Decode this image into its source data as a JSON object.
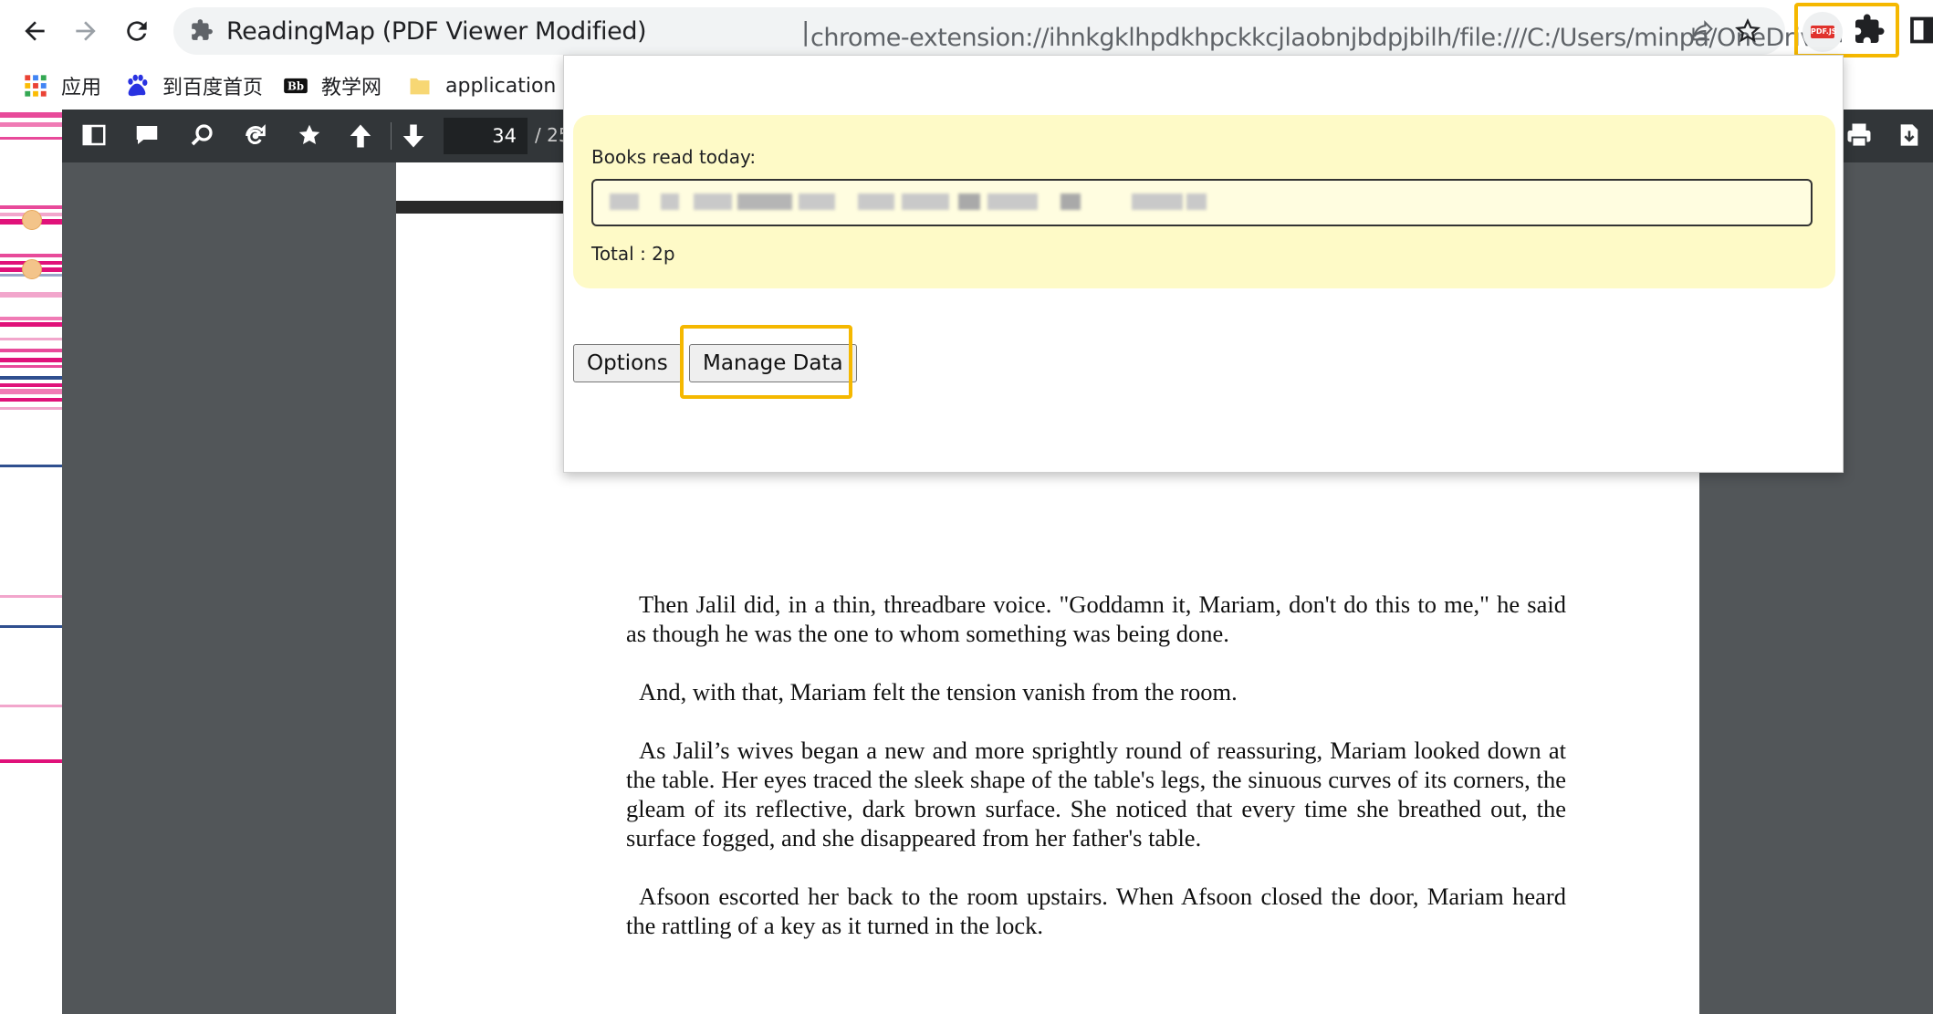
{
  "browser": {
    "tab_extension_name": "ReadingMap (PDF Viewer Modified)",
    "separator": "|",
    "url": "chrome-extension://ihnkgklhpdkhpckkcjlaobnjbdpjbilh/file:///C:/Users/minpa/OneDrive/电子书...",
    "icons": {
      "back": "back-arrow-icon",
      "forward": "forward-arrow-icon",
      "reload": "reload-icon",
      "share": "share-icon",
      "bookmark": "star-icon",
      "pdf_extension": "pdf-extension-icon",
      "extensions": "puzzle-icon",
      "side_panel": "side-panel-icon"
    },
    "pdf_badge": "PDF.JS"
  },
  "bookmarks": [
    {
      "label": "应用",
      "icon": "apps-grid-icon"
    },
    {
      "label": "到百度首页",
      "icon": "baidu-paw-icon"
    },
    {
      "label": "教学网",
      "icon": "blackboard-icon"
    },
    {
      "label": "application",
      "icon": "folder-icon"
    }
  ],
  "pdf_viewer": {
    "current_page": "34",
    "total_pages": "/ 25",
    "toolbar_icons": [
      "sidebar-toggle-icon",
      "comment-icon",
      "search-icon",
      "rotate-icon",
      "star-icon",
      "previous-page-icon",
      "next-page-icon",
      "print-icon",
      "download-icon"
    ],
    "paragraphs": [
      "Then Jalil did, in a thin, threadbare voice. \"Goddamn it, Mariam, don't do this to me,\" he said as though he was the one to whom something was being done.",
      "And, with that, Mariam felt the tension vanish from the room.",
      "As Jalil’s wives began a new and more sprightly round of reassuring, Mariam looked down at the table. Her eyes traced the sleek shape of the table's legs, the sinuous curves of its corners, the gleam of its reflective, dark brown surface. She noticed that every time she breathed out, the surface fogged, and she disappeared from her father's table.",
      "Afsoon escorted her back to the room upstairs. When Afsoon closed the door, Mariam heard the rattling of a key as it turned in the lock."
    ]
  },
  "popup": {
    "books_label": "Books read today:",
    "total": "Total : 2p",
    "options_button": "Options",
    "manage_button": "Manage Data"
  },
  "colors": {
    "highlight": "#f5b800",
    "popup_panel": "#fefac7",
    "toolbar": "#323639",
    "viewer_bg": "#525659"
  }
}
